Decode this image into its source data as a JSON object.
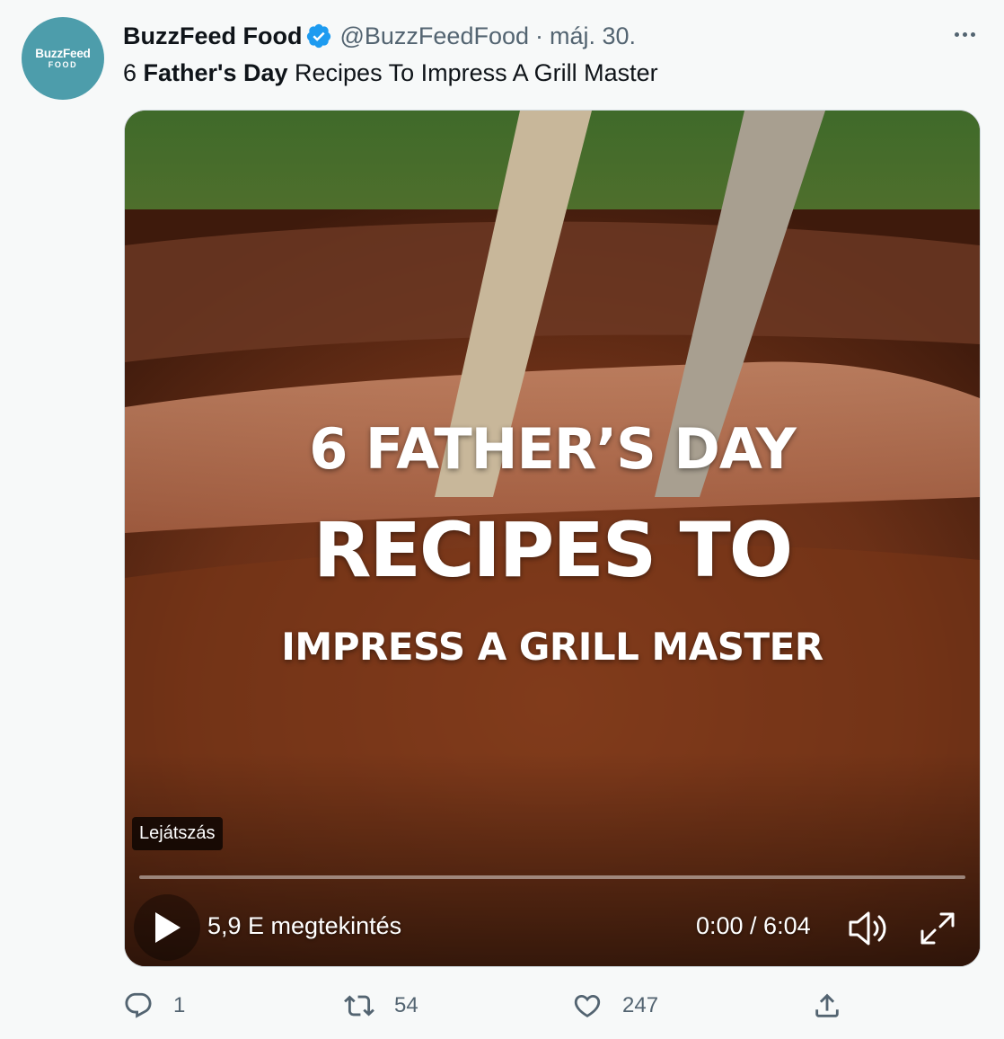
{
  "account": {
    "avatar_brand": "BuzzFeed",
    "avatar_sub": "FOOD",
    "display_name": "BuzzFeed Food",
    "handle": "@BuzzFeedFood",
    "separator": "·",
    "date": "máj. 30."
  },
  "tweet": {
    "text_prefix": "6 ",
    "text_bold": "Father's Day",
    "text_suffix": " Recipes To Impress A Grill Master"
  },
  "video": {
    "overlay_line1": "6 FATHER’S DAY",
    "overlay_line2": "RECIPES TO",
    "overlay_line3": "IMPRESS A GRILL MASTER",
    "play_tooltip": "Lejátszás",
    "views": "5,9 E megtekintés",
    "time": "0:00 / 6:04",
    "progress": 0
  },
  "actions": {
    "replies": "1",
    "retweets": "54",
    "likes": "247"
  },
  "icons": {
    "verified": "verified-badge-icon",
    "more": "more-icon",
    "play": "play-icon",
    "volume": "volume-icon",
    "fullscreen": "fullscreen-icon",
    "reply": "reply-icon",
    "retweet": "retweet-icon",
    "like": "heart-icon",
    "share": "share-icon"
  },
  "colors": {
    "background": "#f7f9f9",
    "avatar": "#4d9dab",
    "verified": "#1d9bf0",
    "secondary_text": "#536471"
  }
}
